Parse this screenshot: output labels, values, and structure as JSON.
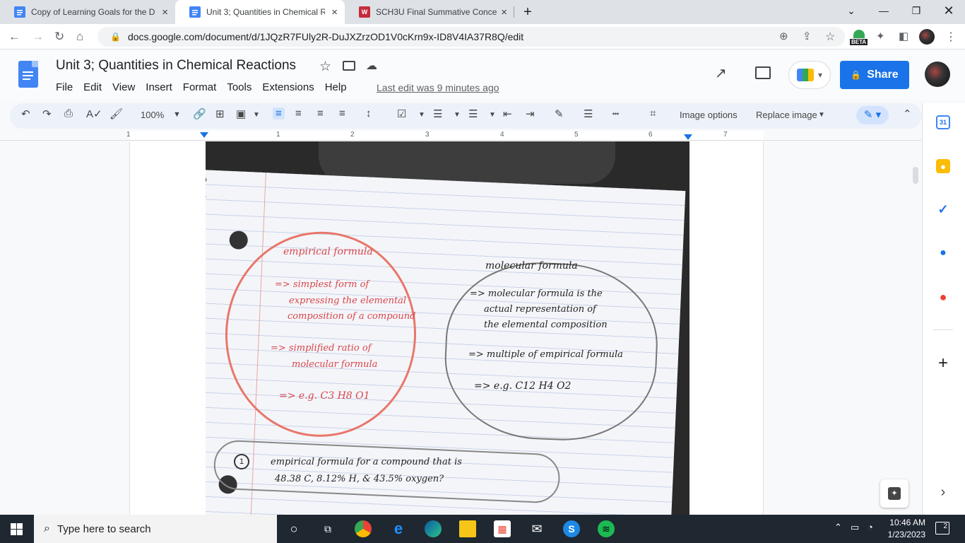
{
  "browser": {
    "tabs": [
      {
        "title": "Copy of Learning Goals for the D",
        "icon": "google-docs-icon",
        "close": "×"
      },
      {
        "title": "Unit 3; Quantities in Chemical Re",
        "icon": "google-docs-icon",
        "close": "×"
      },
      {
        "title": "SCH3U Final Summative Concept",
        "icon": "wecourse-icon",
        "close": "×"
      }
    ],
    "new_tab": "+",
    "url": "docs.google.com/document/d/1JQzR7FUly2R-DuJXZrzOD1V0cKrn9x-ID8V4IA37R8Q/edit",
    "beta_label": "BETA"
  },
  "doc": {
    "title": "Unit 3; Quantities in Chemical Reactions",
    "menu": [
      "File",
      "Edit",
      "View",
      "Insert",
      "Format",
      "Tools",
      "Extensions",
      "Help"
    ],
    "last_edit": "Last edit was 9 minutes ago",
    "share_label": "Share",
    "share_icon": "lock-icon"
  },
  "toolbar": {
    "zoom": "100%",
    "image_options": "Image options",
    "replace_image": "Replace image"
  },
  "ruler": {
    "numbers": [
      "1",
      "1",
      "2",
      "3",
      "4",
      "5",
      "6",
      "7"
    ]
  },
  "notes": {
    "empirical_title": "empirical formula",
    "emp_1a": "=> simplest form of",
    "emp_1b": "expressing the elemental",
    "emp_1c": "composition of a compound",
    "emp_2a": "=> simplified ratio of",
    "emp_2b": "molecular formula",
    "emp_3": "=> e.g.  C3 H8 O1",
    "molecular_title": "molecular formula",
    "mol_1a": "=> molecular formula is the",
    "mol_1b": "actual representation of",
    "mol_1c": "the elemental composition",
    "mol_2": "=> multiple of empirical formula",
    "mol_3": "=> e.g.  C12 H4 O2",
    "q1_num": "1",
    "q1_a": "empirical formula for a compound that is",
    "q1_b": "48.38 C,  8.12% H,  &  43.5%  oxygen?"
  },
  "side_panel": {
    "calendar_day": "31",
    "add": "+",
    "expand": "›"
  },
  "taskbar": {
    "search_placeholder": "Type here to search",
    "time": "10:46 AM",
    "date": "1/23/2023",
    "notifications": "2"
  },
  "colors": {
    "docs_blue": "#4285f4",
    "share_blue": "#1a73e8",
    "ink_red": "#d8464a",
    "taskbar": "#1f2731"
  }
}
